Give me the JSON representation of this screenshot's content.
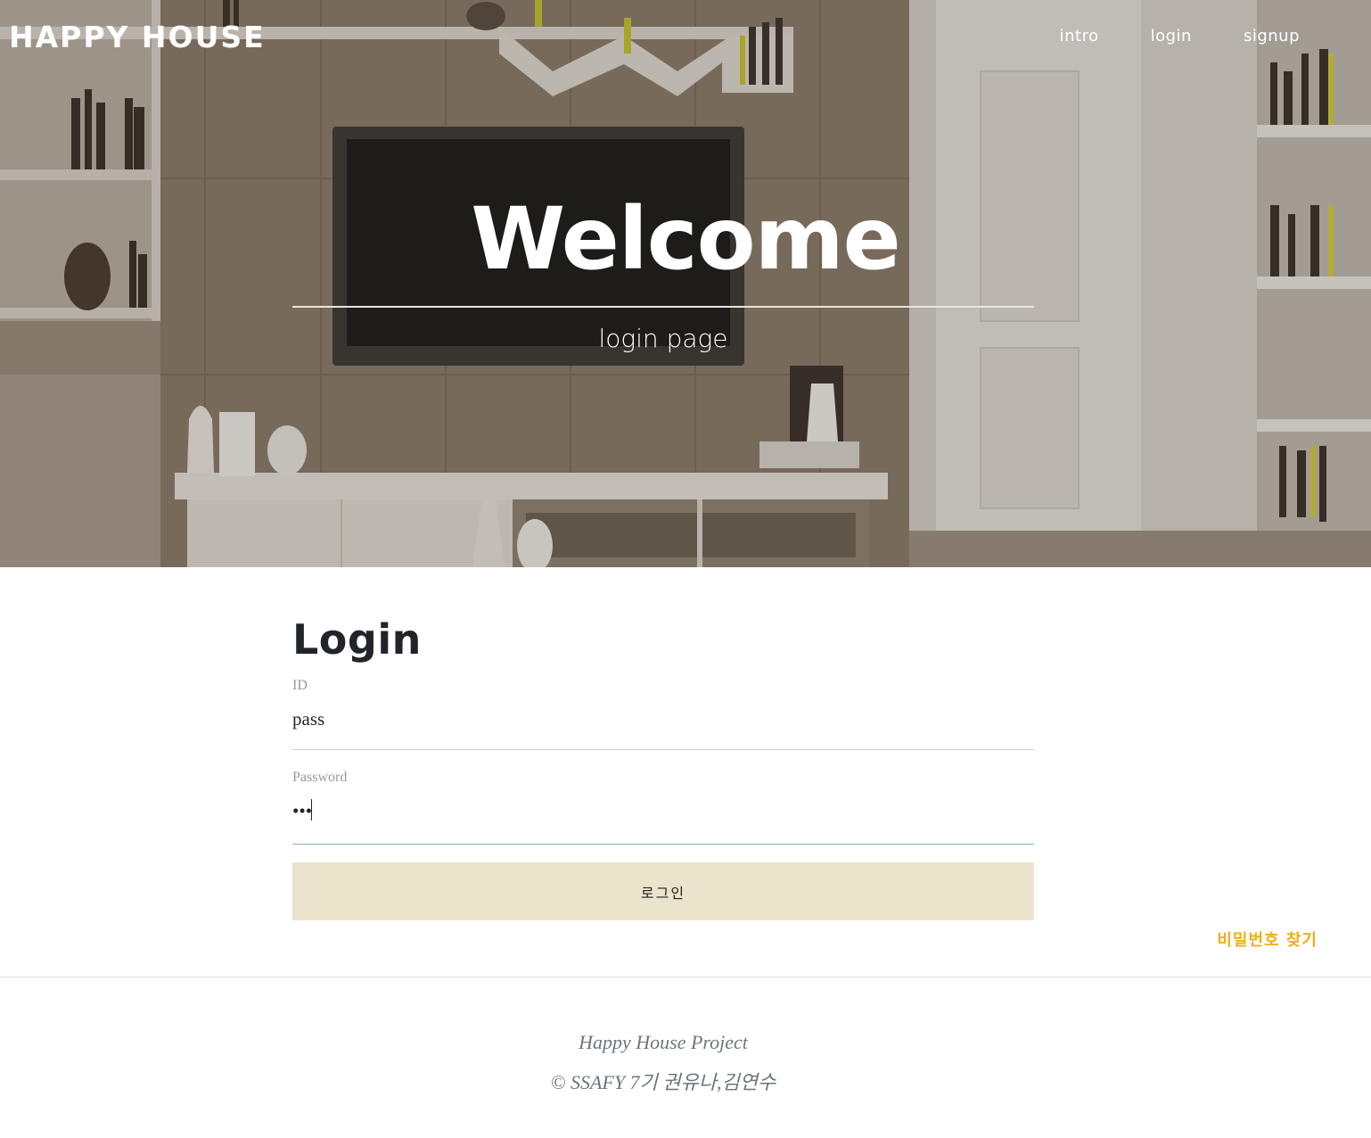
{
  "header": {
    "brand": "HAPPY HOUSE",
    "nav": [
      {
        "label": "intro"
      },
      {
        "label": "login"
      },
      {
        "label": "signup"
      }
    ]
  },
  "hero": {
    "title": "Welcome",
    "subtitle": "login page"
  },
  "login": {
    "heading": "Login",
    "id_label": "ID",
    "id_value": "pass",
    "password_label": "Password",
    "password_value": "•••",
    "submit_label": "로그인",
    "find_password_label": "비밀번호 찾기"
  },
  "footer": {
    "project": "Happy House Project",
    "credits": "© SSAFY 7기 권유나,김연수"
  },
  "colors": {
    "button_bg": "#ebe4cd",
    "link_accent": "#f0ad1a",
    "heading": "#212529",
    "footer_text": "#6c757d"
  }
}
